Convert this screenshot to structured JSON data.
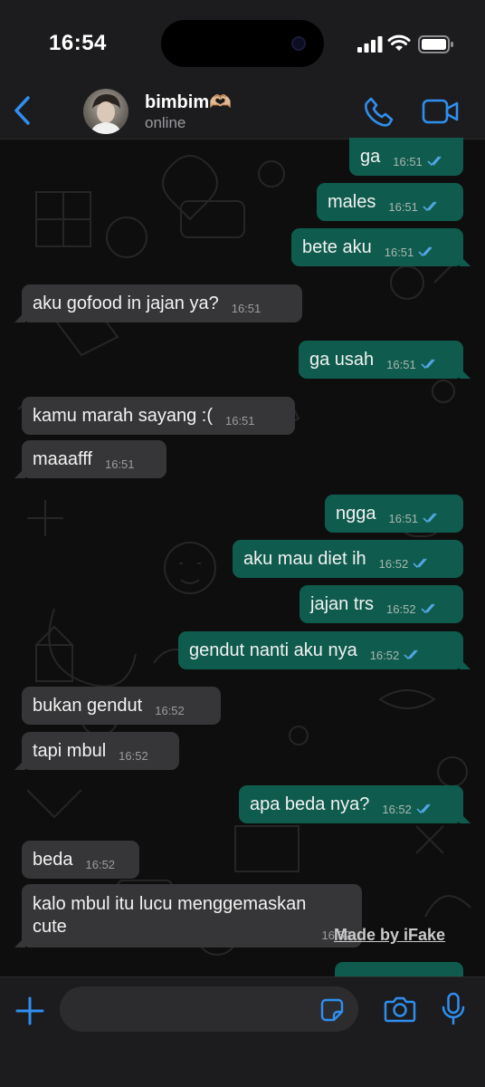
{
  "status_bar": {
    "time": "16:54"
  },
  "header": {
    "contact_name": "bimbim🫶🏼",
    "contact_status": "online"
  },
  "messages": [
    {
      "dir": "out",
      "text": "ga",
      "time": "16:51",
      "read": true
    },
    {
      "dir": "out",
      "text": "males",
      "time": "16:51",
      "read": true
    },
    {
      "dir": "out",
      "text": "bete aku",
      "time": "16:51",
      "read": true
    },
    {
      "dir": "in",
      "text": "aku gofood in jajan ya?",
      "time": "16:51"
    },
    {
      "dir": "out",
      "text": "ga usah",
      "time": "16:51",
      "read": true
    },
    {
      "dir": "in",
      "text": "kamu marah sayang :(",
      "time": "16:51"
    },
    {
      "dir": "in",
      "text": "maaafff",
      "time": "16:51"
    },
    {
      "dir": "out",
      "text": "ngga",
      "time": "16:51",
      "read": true
    },
    {
      "dir": "out",
      "text": "aku mau diet ih",
      "time": "16:52",
      "read": true
    },
    {
      "dir": "out",
      "text": "jajan trs",
      "time": "16:52",
      "read": true
    },
    {
      "dir": "out",
      "text": "gendut nanti aku nya",
      "time": "16:52",
      "read": true
    },
    {
      "dir": "in",
      "text": "bukan gendut",
      "time": "16:52"
    },
    {
      "dir": "in",
      "text": "tapi mbul",
      "time": "16:52"
    },
    {
      "dir": "out",
      "text": "apa beda nya?",
      "time": "16:52",
      "read": true
    },
    {
      "dir": "in",
      "text": "beda",
      "time": "16:52"
    },
    {
      "dir": "in",
      "lines": [
        "kalo mbul itu lucu menggemaskan",
        "cute"
      ],
      "time": "16:52"
    }
  ],
  "watermark": "Made by iFake",
  "colors": {
    "outgoing_bubble": "#0f5c4e",
    "incoming_bubble": "#363638",
    "accent": "#2f8ff0",
    "read_ticks": "#53a6e6"
  },
  "icons": [
    "back-chevron-icon",
    "phone-icon",
    "video-icon",
    "plus-icon",
    "sticker-icon",
    "camera-icon",
    "microphone-icon"
  ]
}
